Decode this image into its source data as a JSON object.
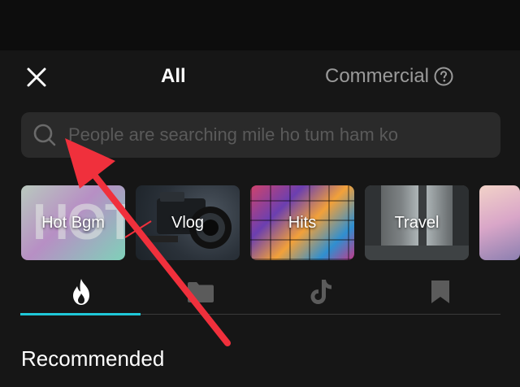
{
  "header": {
    "tab_all": "All",
    "tab_commercial": "Commercial"
  },
  "search": {
    "placeholder": "People are searching mile ho tum ham ko"
  },
  "categories": [
    {
      "label": "Hot Bgm",
      "art_text": "HOT"
    },
    {
      "label": "Vlog"
    },
    {
      "label": "Hits"
    },
    {
      "label": "Travel"
    },
    {
      "label": ""
    }
  ],
  "tabs": [
    {
      "icon": "flame-icon",
      "active": true
    },
    {
      "icon": "folder-icon",
      "active": false
    },
    {
      "icon": "tiktok-icon",
      "active": false
    },
    {
      "icon": "bookmark-icon",
      "active": false
    }
  ],
  "section": {
    "title": "Recommended"
  },
  "colors": {
    "background": "#161616",
    "active_tab_indicator": "#1fc8d8",
    "annotation_arrow": "#f0303c"
  }
}
